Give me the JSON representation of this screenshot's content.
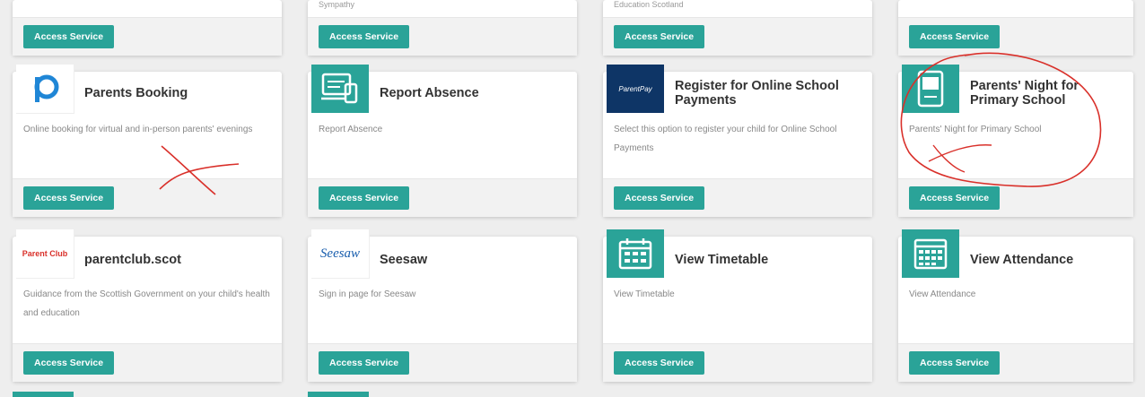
{
  "button_label": "Access Service",
  "top_row": {
    "col2_text": "Sympathy",
    "col3_text": "Education Scotland"
  },
  "cards": [
    {
      "title": "Parents Booking",
      "desc": "Online booking for virtual and in-person parents' evenings",
      "icon": "pb-logo-icon"
    },
    {
      "title": "Report Absence",
      "desc": "Report Absence",
      "icon": "report-absence-icon"
    },
    {
      "title": "Register for Online School Payments",
      "desc": "Select this option to register your child for Online School Payments",
      "icon": "parentpay-logo-icon",
      "icon_text": "ParentPay"
    },
    {
      "title": "Parents' Night for Primary School",
      "desc": "Parents' Night for Primary School",
      "icon": "parents-night-icon"
    },
    {
      "title": "parentclub.scot",
      "desc": "Guidance from the Scottish Government on your child's health and education",
      "icon": "parentclub-logo-icon",
      "icon_text": "Parent Club"
    },
    {
      "title": "Seesaw",
      "desc": "Sign in page for Seesaw",
      "icon": "seesaw-logo-icon",
      "icon_text": "Seesaw"
    },
    {
      "title": "View Timetable",
      "desc": "View Timetable",
      "icon": "timetable-icon"
    },
    {
      "title": "View Attendance",
      "desc": "View Attendance",
      "icon": "attendance-icon"
    }
  ],
  "colors": {
    "accent": "#2aa398",
    "annotation": "#d9302a",
    "parentpay_navy": "#0e3566"
  }
}
